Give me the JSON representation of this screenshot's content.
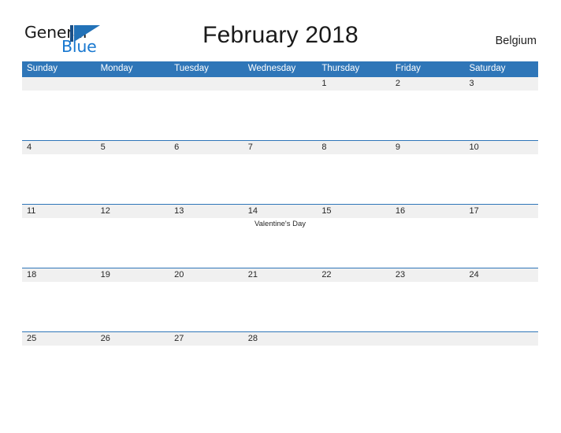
{
  "branding": {
    "logo_primary": "General",
    "logo_secondary": "Blue",
    "logo_mark_icon": "flag-triangle-icon",
    "accent_blue": "#2f76b8",
    "logo_blue": "#1878d0",
    "logo_dark_blue": "#1a4f86"
  },
  "header": {
    "title": "February 2018",
    "region": "Belgium"
  },
  "calendar": {
    "month": "February",
    "year": "2018",
    "weekday_headers": [
      "Sunday",
      "Monday",
      "Tuesday",
      "Wednesday",
      "Thursday",
      "Friday",
      "Saturday"
    ],
    "band_color": "#f0f0f0",
    "weeks": [
      {
        "days": [
          {
            "number": "",
            "event": ""
          },
          {
            "number": "",
            "event": ""
          },
          {
            "number": "",
            "event": ""
          },
          {
            "number": "",
            "event": ""
          },
          {
            "number": "1",
            "event": ""
          },
          {
            "number": "2",
            "event": ""
          },
          {
            "number": "3",
            "event": ""
          }
        ]
      },
      {
        "days": [
          {
            "number": "4",
            "event": ""
          },
          {
            "number": "5",
            "event": ""
          },
          {
            "number": "6",
            "event": ""
          },
          {
            "number": "7",
            "event": ""
          },
          {
            "number": "8",
            "event": ""
          },
          {
            "number": "9",
            "event": ""
          },
          {
            "number": "10",
            "event": ""
          }
        ]
      },
      {
        "days": [
          {
            "number": "11",
            "event": ""
          },
          {
            "number": "12",
            "event": ""
          },
          {
            "number": "13",
            "event": ""
          },
          {
            "number": "14",
            "event": "Valentine's Day"
          },
          {
            "number": "15",
            "event": ""
          },
          {
            "number": "16",
            "event": ""
          },
          {
            "number": "17",
            "event": ""
          }
        ]
      },
      {
        "days": [
          {
            "number": "18",
            "event": ""
          },
          {
            "number": "19",
            "event": ""
          },
          {
            "number": "20",
            "event": ""
          },
          {
            "number": "21",
            "event": ""
          },
          {
            "number": "22",
            "event": ""
          },
          {
            "number": "23",
            "event": ""
          },
          {
            "number": "24",
            "event": ""
          }
        ]
      },
      {
        "days": [
          {
            "number": "25",
            "event": ""
          },
          {
            "number": "26",
            "event": ""
          },
          {
            "number": "27",
            "event": ""
          },
          {
            "number": "28",
            "event": ""
          },
          {
            "number": "",
            "event": ""
          },
          {
            "number": "",
            "event": ""
          },
          {
            "number": "",
            "event": ""
          }
        ]
      }
    ]
  }
}
